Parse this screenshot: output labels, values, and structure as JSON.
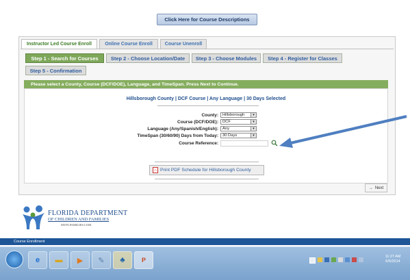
{
  "top_button": {
    "label": "Click Here for Course Descriptions"
  },
  "tabs": [
    {
      "label": "Instructor Led Course Enroll",
      "active": true
    },
    {
      "label": "Online Course Enroll",
      "active": false
    },
    {
      "label": "Course Unenroll",
      "active": false
    }
  ],
  "steps": [
    {
      "label": "Step 1 - Search for Courses",
      "active": true
    },
    {
      "label": "Step 2 - Choose Location/Date",
      "active": false
    },
    {
      "label": "Step 3 - Choose Modules",
      "active": false
    },
    {
      "label": "Step 4 - Register for Classes",
      "active": false
    },
    {
      "label": "Step 5 - Confirmation",
      "active": false
    }
  ],
  "instructions": "Please select a County, Course (DCF/DOE), Language, and TimeSpan. Press Next to Continue.",
  "summary": "Hillsborough County | DCF Course | Any Language | 30 Days Selected",
  "form": {
    "county": {
      "label": "County:",
      "value": "Hillsborough"
    },
    "course": {
      "label": "Course (DCF/DOE):",
      "value": "DCF"
    },
    "language": {
      "label": "Language (Any/Spanish/English):",
      "value": "Any"
    },
    "timespan": {
      "label": "TimeSpan (30/60/90) Days from Today:",
      "value": "30 Days"
    },
    "reference": {
      "label": "Course Reference:",
      "value": ""
    }
  },
  "pdf_button": {
    "label": "Print PDF Schedule for Hillsborough County"
  },
  "next_button": {
    "label": "Next"
  },
  "logo": {
    "line1": "FLORIDA DEPARTMENT",
    "line2": "OF CHILDREN AND FAMILIES",
    "line3": "MYFLFAMILIES.COM"
  },
  "status_bar": {
    "label": "Course Enrollment"
  },
  "clock": {
    "time": "11:27 AM",
    "date": "6/5/2014"
  },
  "colors": {
    "accent_green": "#85ad5e",
    "link_blue": "#2e5d9e",
    "annotation_arrow": "#4f7fc0",
    "status_bar": "#1d5597"
  }
}
